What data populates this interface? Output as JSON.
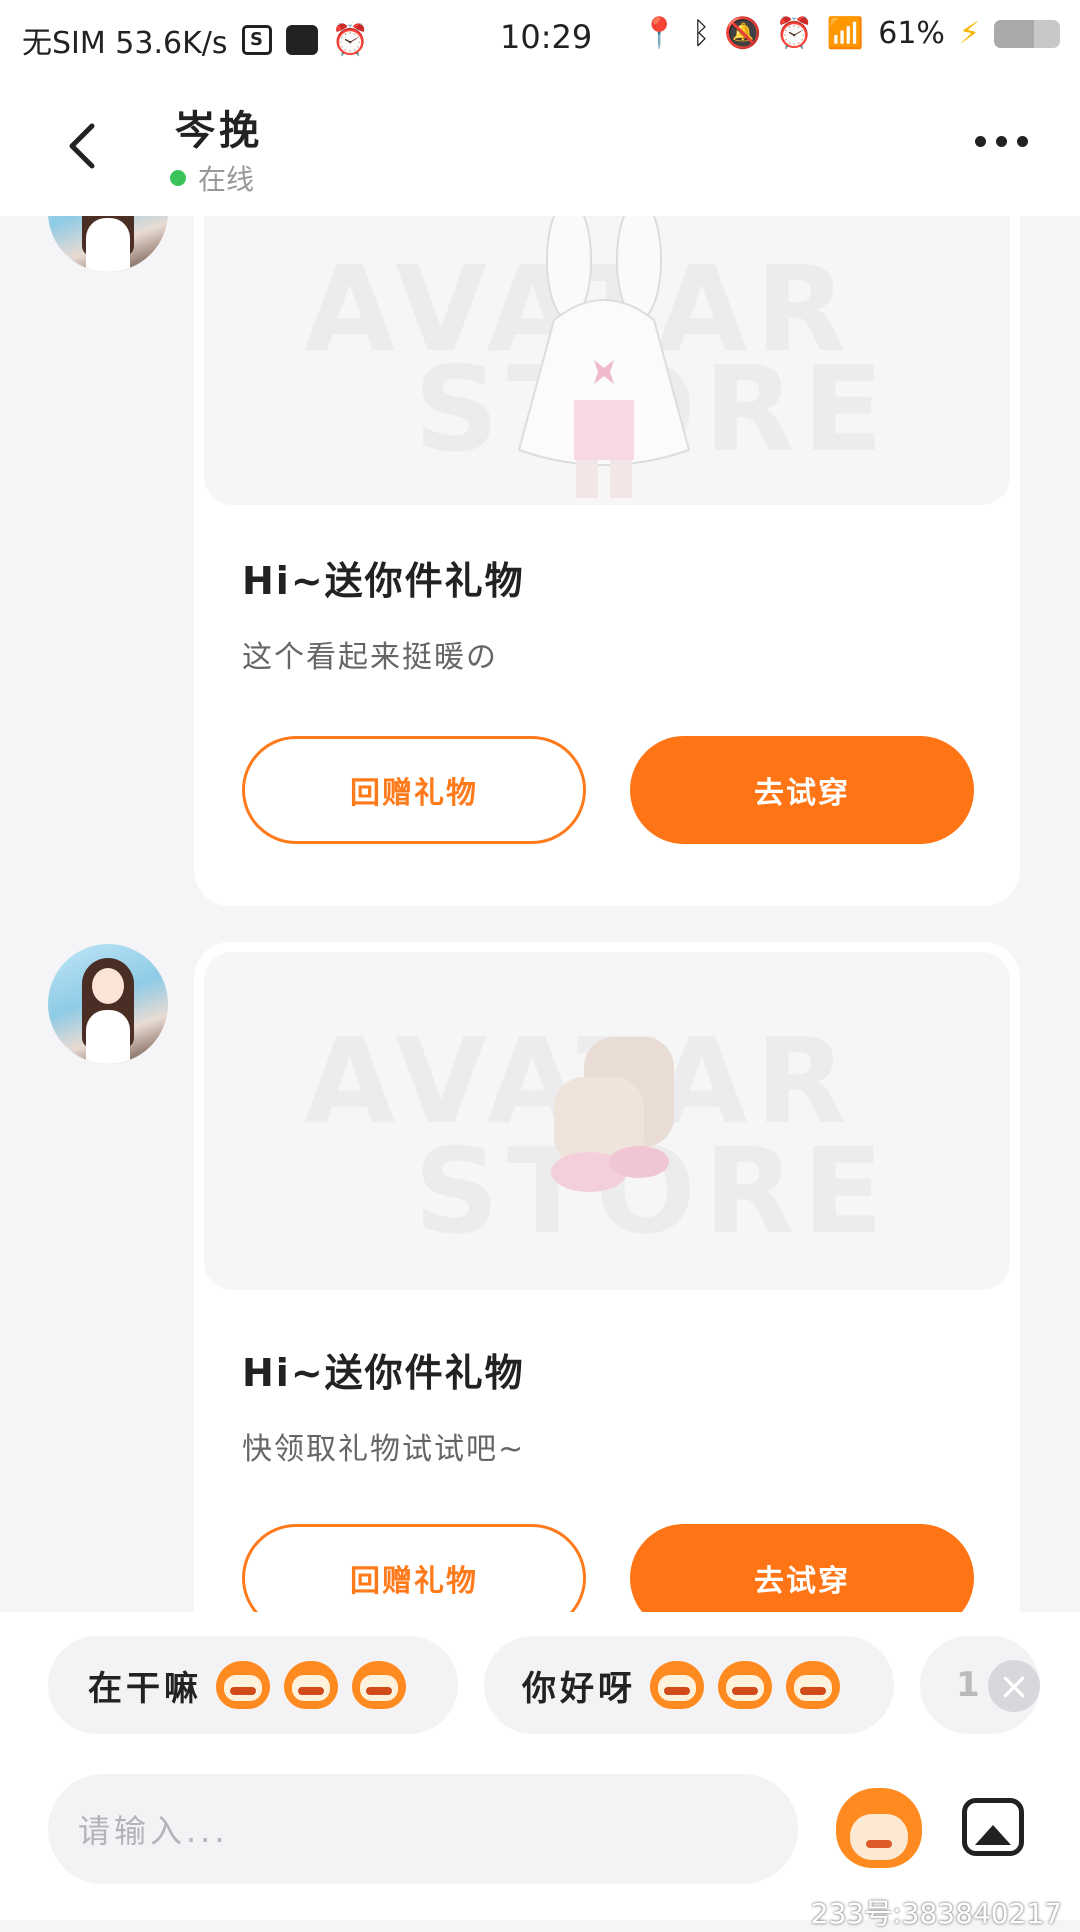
{
  "status_bar": {
    "left_text": "无SIM 53.6K/s",
    "time": "10:29",
    "battery": "61%",
    "battery_level": 0.61
  },
  "header": {
    "title": "岑挽",
    "status": "在线"
  },
  "messages": [
    {
      "title": "Hi~送你件礼物",
      "subtitle": "这个看起来挺暖の",
      "return_label": "回赠礼物",
      "try_label": "去试穿",
      "image_watermark_1": "AVATAR",
      "image_watermark_2": "STORE",
      "item": "white-bunny-hoodie-outfit"
    },
    {
      "title": "Hi~送你件礼物",
      "subtitle": "快领取礼物试试吧~",
      "return_label": "回赠礼物",
      "try_label": "去试穿",
      "image_watermark_1": "AVATAR",
      "image_watermark_2": "STORE",
      "item": "fluffy-slipper-boots"
    }
  ],
  "quick_replies": [
    {
      "text": "在干嘛",
      "emoji": "grin-monkey-emoji"
    },
    {
      "text": "你好呀",
      "emoji": "surprised-monkey-emoji"
    },
    {
      "text": "1",
      "emoji": ""
    }
  ],
  "input": {
    "placeholder": "请输入..."
  },
  "overlay_watermark": "233号:383840217",
  "colors": {
    "accent": "#ff7414",
    "online": "#3bc35b"
  }
}
